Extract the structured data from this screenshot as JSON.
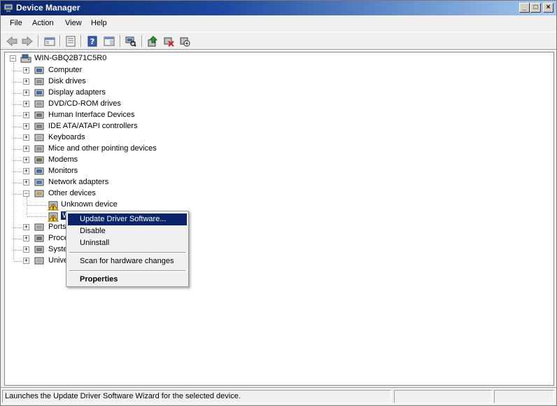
{
  "window": {
    "title": "Device Manager",
    "controls": {
      "minimize": "_",
      "maximize": "□",
      "close": "×"
    }
  },
  "menubar": {
    "items": [
      "File",
      "Action",
      "View",
      "Help"
    ]
  },
  "toolbar": {
    "buttons": [
      "back-icon",
      "forward-icon",
      "up-folder-icon",
      "properties-icon",
      "help-icon",
      "action-pane-icon",
      "scan-hardware-icon",
      "update-driver-icon",
      "uninstall-icon",
      "disable-icon"
    ]
  },
  "tree": {
    "root": "WIN-GBQ2B71C5R0",
    "categories": [
      "Computer",
      "Disk drives",
      "Display adapters",
      "DVD/CD-ROM drives",
      "Human Interface Devices",
      "IDE ATA/ATAPI controllers",
      "Keyboards",
      "Mice and other pointing devices",
      "Modems",
      "Monitors",
      "Network adapters",
      "Other devices"
    ],
    "other_devices_children": [
      "Unknown device",
      "W"
    ],
    "categories_after": [
      "Ports",
      "Proce",
      "Syste",
      "Unive"
    ]
  },
  "context_menu": {
    "items": [
      {
        "label": "Update Driver Software...",
        "highlighted": true
      },
      {
        "label": "Disable"
      },
      {
        "label": "Uninstall"
      },
      {
        "label": "Scan for hardware changes"
      },
      {
        "label": "Properties",
        "bold": true
      }
    ]
  },
  "statusbar": {
    "text": "Launches the Update Driver Software Wizard for the selected device."
  },
  "colors": {
    "title_gradient_start": "#0a246a",
    "highlight": "#0a246a",
    "warning": "#f5c518"
  }
}
